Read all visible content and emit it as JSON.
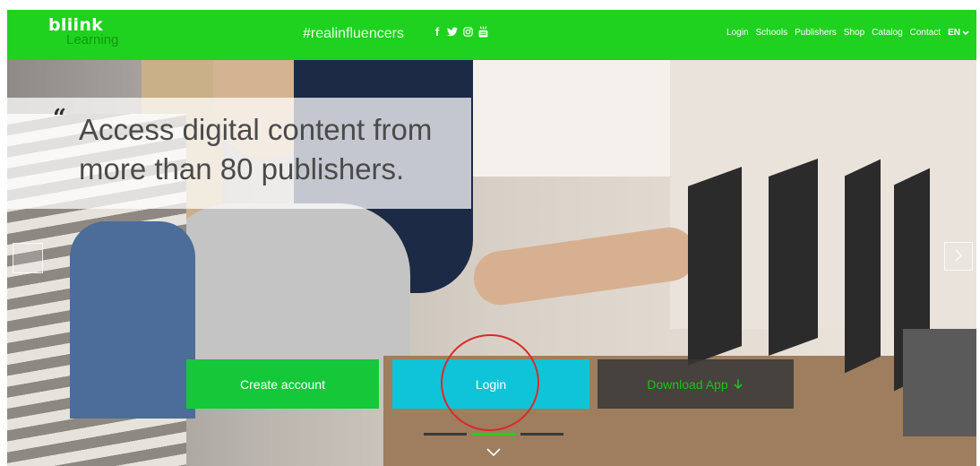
{
  "header": {
    "logo": {
      "line1": "bliink",
      "line2": "Learning"
    },
    "tagline": "#realinfluencers",
    "social": [
      {
        "name": "facebook-icon",
        "glyph": "f"
      },
      {
        "name": "twitter-icon",
        "glyph": ""
      },
      {
        "name": "instagram-icon",
        "glyph": ""
      },
      {
        "name": "youtube-icon",
        "glyph": ""
      }
    ],
    "nav": [
      "Login",
      "Schools",
      "Publishers",
      "Shop",
      "Catalog",
      "Contact"
    ],
    "language": "EN"
  },
  "hero": {
    "quote_mark": "“",
    "headline_line1": "Access digital content from",
    "headline_line2": "more than 80 publishers.",
    "buttons": {
      "create": "Create account",
      "login": "Login",
      "download": "Download App"
    },
    "slides": {
      "count": 3,
      "active": 2
    }
  },
  "colors": {
    "brand_green": "#1fd21f",
    "create_button": "#14c83a",
    "login_button": "#0fc4d8",
    "download_button": "#373737",
    "annotation_circle": "#d92a2a"
  }
}
